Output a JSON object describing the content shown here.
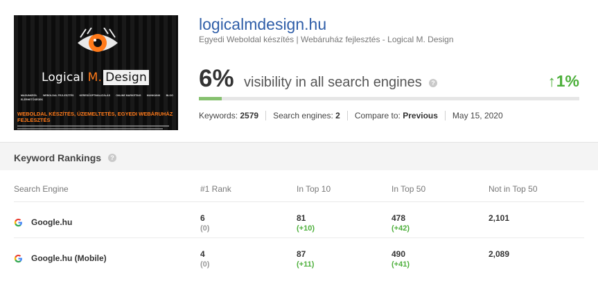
{
  "thumbnail": {
    "logo_text_a": "Logical ",
    "logo_text_m": "M.",
    "logo_text_b": "Design",
    "nav": [
      "MAGUNKRÓL",
      "WEBOLDAL FEJLESZTÉS",
      "KERESŐOPTIMALIZÁLÁS",
      "ONLINE MARKETING",
      "MUNKÁINK",
      "BLOG",
      "ELÉRHETŐSÉGEK"
    ],
    "headline": "WEBOLDAL KÉSZÍTÉS, ÜZEMELTETÉS, EGYEDI WEBÁRUHÁZ FEJLESZTÉS"
  },
  "site": {
    "title": "logicalmdesign.hu",
    "subtitle": "Egyedi Weboldal készítés | Webáruház fejlesztés - Logical M. Design"
  },
  "visibility": {
    "percent_label": "6%",
    "percent_value": 6,
    "label": "visibility in all search engines",
    "change_arrow": "↑",
    "change": "1%",
    "help_glyph": "?"
  },
  "meta": {
    "keywords_label": "Keywords:",
    "keywords_value": "2579",
    "engines_label": "Search engines:",
    "engines_value": "2",
    "compare_label": "Compare to:",
    "compare_value": "Previous",
    "date": "May 15, 2020"
  },
  "rankings": {
    "title": "Keyword Rankings",
    "help_glyph": "?",
    "columns": [
      "Search Engine",
      "#1 Rank",
      "In Top 10",
      "In Top 50",
      "Not in Top 50"
    ],
    "rows": [
      {
        "engine": "Google.hu",
        "rank1": "6",
        "rank1_delta": "(0)",
        "top10": "81",
        "top10_delta": "(+10)",
        "top50": "478",
        "top50_delta": "(+42)",
        "not50": "2,101"
      },
      {
        "engine": "Google.hu (Mobile)",
        "rank1": "4",
        "rank1_delta": "(0)",
        "top10": "87",
        "top10_delta": "(+11)",
        "top50": "490",
        "top50_delta": "(+41)",
        "not50": "2,089"
      }
    ]
  },
  "colors": {
    "link_blue": "#2f5ea8",
    "positive_green": "#4caf3a",
    "progress_green": "#86c16f",
    "logo_orange": "#ff7a1a"
  }
}
